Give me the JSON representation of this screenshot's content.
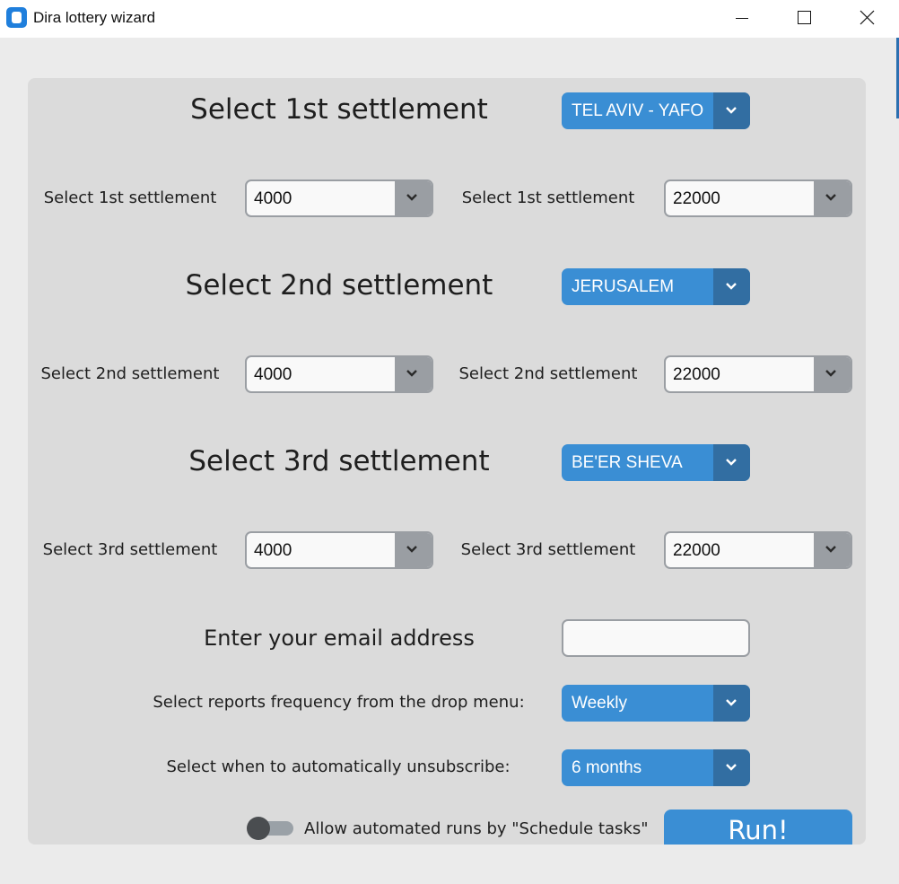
{
  "window": {
    "title": "Dira lottery wizard"
  },
  "settlements": [
    {
      "heading": "Select 1st settlement",
      "city": "TEL AVIV - YAFO",
      "min_label": "Select 1st settlement",
      "min_value": "4000",
      "max_label": "Select 1st settlement",
      "max_value": "22000"
    },
    {
      "heading": "Select 2nd settlement",
      "city": "JERUSALEM",
      "min_label": "Select 2nd settlement",
      "min_value": "4000",
      "max_label": "Select 2nd settlement",
      "max_value": "22000"
    },
    {
      "heading": "Select 3rd settlement",
      "city": "BE'ER SHEVA",
      "min_label": "Select 3rd settlement",
      "min_value": "4000",
      "max_label": "Select 3rd settlement",
      "max_value": "22000"
    }
  ],
  "email": {
    "label": "Enter your email address",
    "value": ""
  },
  "frequency": {
    "label": "Select reports frequency from the drop menu:",
    "value": "Weekly"
  },
  "unsubscribe": {
    "label": "Select when to automatically unsubscribe:",
    "value": "6 months"
  },
  "schedule": {
    "label": "Allow automated runs by \"Schedule tasks\"",
    "enabled": false
  },
  "run_button": {
    "label": "Run!"
  },
  "colors": {
    "accent": "#3a8ed4",
    "accent_dark": "#326ea2",
    "panel": "#dbdbdb",
    "combo_border": "#9a9ea3"
  }
}
